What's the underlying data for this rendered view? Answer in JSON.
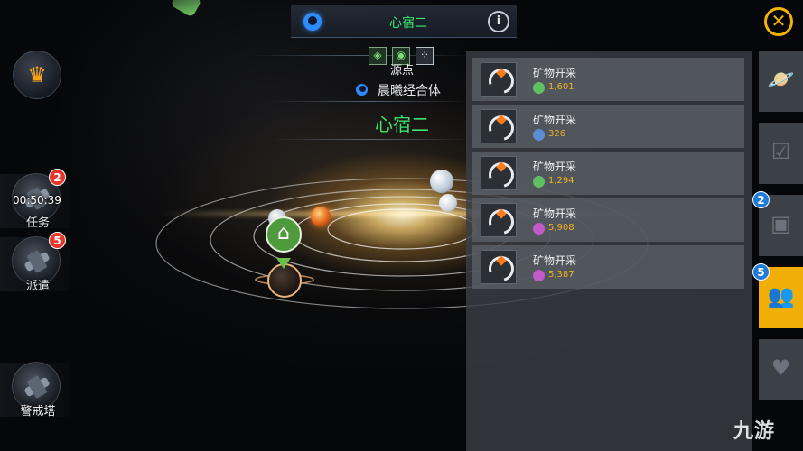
{
  "top_bar": {
    "title": "心宿二",
    "faction_icon": "faction-emblem-blue",
    "info_icon": "i"
  },
  "close_button": {
    "icon": "✕"
  },
  "left_menu": {
    "crown_icon": "♛",
    "mission": {
      "label": "任务",
      "timer": "00:50:39",
      "badge": "2"
    },
    "dispatch": {
      "label": "派遣",
      "badge": "5"
    },
    "watchtower": {
      "label": "警戒塔"
    }
  },
  "center_info": {
    "mode_icons": [
      "◈",
      "◉",
      "⁘"
    ],
    "origin_label": "源点",
    "owner_name": "晨曦经合体",
    "system_name": "心宿二",
    "name_color": "#3fe26f"
  },
  "task_list": [
    {
      "title": "矿物开采",
      "resource_icon": "green-ore",
      "resource_color": "#5fbf62",
      "amount": "1,601"
    },
    {
      "title": "矿物开采",
      "resource_icon": "blue-ore",
      "resource_color": "#5a8fd6",
      "amount": "326"
    },
    {
      "title": "矿物开采",
      "resource_icon": "green-ore",
      "resource_color": "#5fbf62",
      "amount": "1,294"
    },
    {
      "title": "矿物开采",
      "resource_icon": "purple-ore",
      "resource_color": "#c05bc8",
      "amount": "5,908"
    },
    {
      "title": "矿物开采",
      "resource_icon": "purple-ore",
      "resource_color": "#c05bc8",
      "amount": "5,387"
    }
  ],
  "right_tabs": [
    {
      "name": "planet",
      "icon": "🪐",
      "badge": ""
    },
    {
      "name": "mission-list",
      "icon": "☑",
      "badge": ""
    },
    {
      "name": "building",
      "icon": "▣",
      "badge": "2"
    },
    {
      "name": "crew",
      "icon": "👥",
      "badge": "5"
    },
    {
      "name": "defense",
      "icon": "♥",
      "badge": ""
    }
  ],
  "watermark": "九游"
}
